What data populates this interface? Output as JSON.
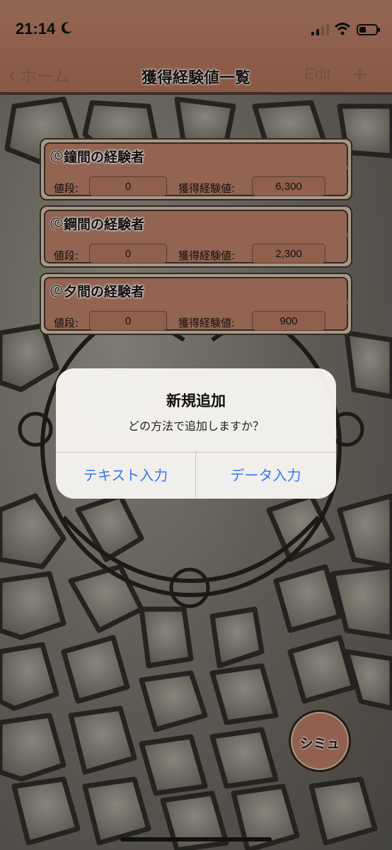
{
  "status_bar": {
    "time": "21:14"
  },
  "nav": {
    "back_label": "ホーム",
    "title": "獲得経験値一覧",
    "edit_label": "Edit",
    "add_label": "+"
  },
  "cards": [
    {
      "title": "鐘間の経験者",
      "price_label": "値段:",
      "price_value": "0",
      "exp_label": "獲得経験値:",
      "exp_value": "6,300"
    },
    {
      "title": "鋼間の経験者",
      "price_label": "値段:",
      "price_value": "0",
      "exp_label": "獲得経験値:",
      "exp_value": "2,300"
    },
    {
      "title": "夕間の経験者",
      "price_label": "値段:",
      "price_value": "0",
      "exp_label": "獲得経験値:",
      "exp_value": "900"
    }
  ],
  "alert": {
    "title": "新規追加",
    "message": "どの方法で追加しますか？",
    "buttons": [
      "テキスト入力",
      "データ入力"
    ]
  },
  "fab": {
    "label": "シミュ"
  },
  "colors": {
    "accent": "#b37a63",
    "card_border": "#3f3229",
    "alert_button": "#3478f6"
  }
}
